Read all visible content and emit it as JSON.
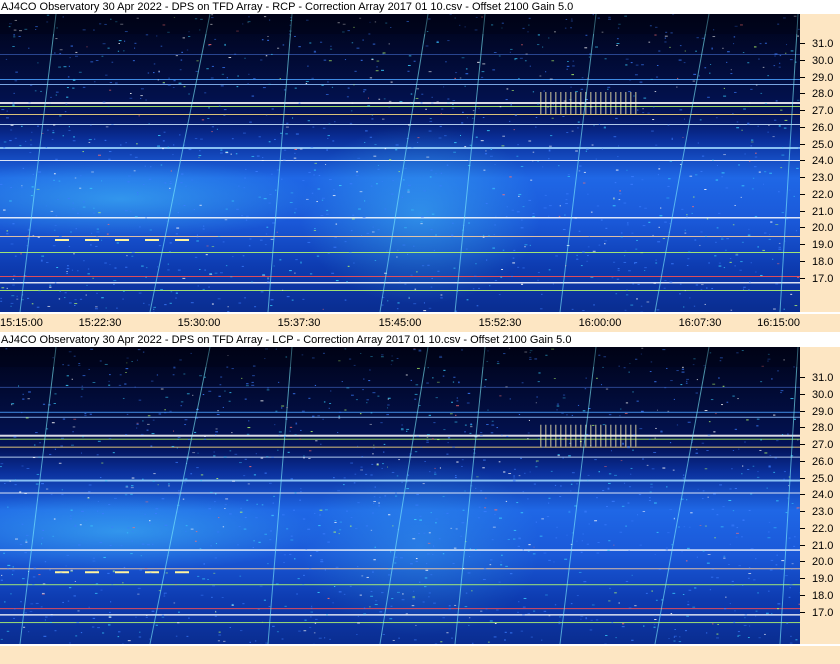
{
  "colors": {
    "background": "#041a6b",
    "axis_background": "#fde6c3",
    "band_dark": "#000a3a",
    "band_blue": "#1a5ee0",
    "band_cyan": "#3ad0ff",
    "line_green": "#b8ff6a",
    "line_red": "#ff5050"
  },
  "panels": [
    {
      "name": "rcp",
      "title": "AJ4CO Observatory 30 Apr 2022  -  DPS on TFD Array  -  RCP  -  Correction Array 2017 01 10.csv  -  Offset 2100  Gain 5.0"
    },
    {
      "name": "lcp",
      "title": "AJ4CO Observatory 30 Apr 2022  -  DPS on TFD Array  -  LCP  -  Correction Array 2017 01 10.csv  -  Offset 2100  Gain 5.0"
    }
  ],
  "y_ticks": [
    "31.0",
    "30.0",
    "29.0",
    "28.0",
    "27.0",
    "26.0",
    "25.0",
    "24.0",
    "23.0",
    "22.0",
    "21.0",
    "20.0",
    "19.0",
    "18.0",
    "17.0"
  ],
  "x_ticks": [
    "15:15:00",
    "15:22:30",
    "15:30:00",
    "15:37:30",
    "15:45:00",
    "15:52:30",
    "16:00:00",
    "16:07:30",
    "16:15:00"
  ]
}
